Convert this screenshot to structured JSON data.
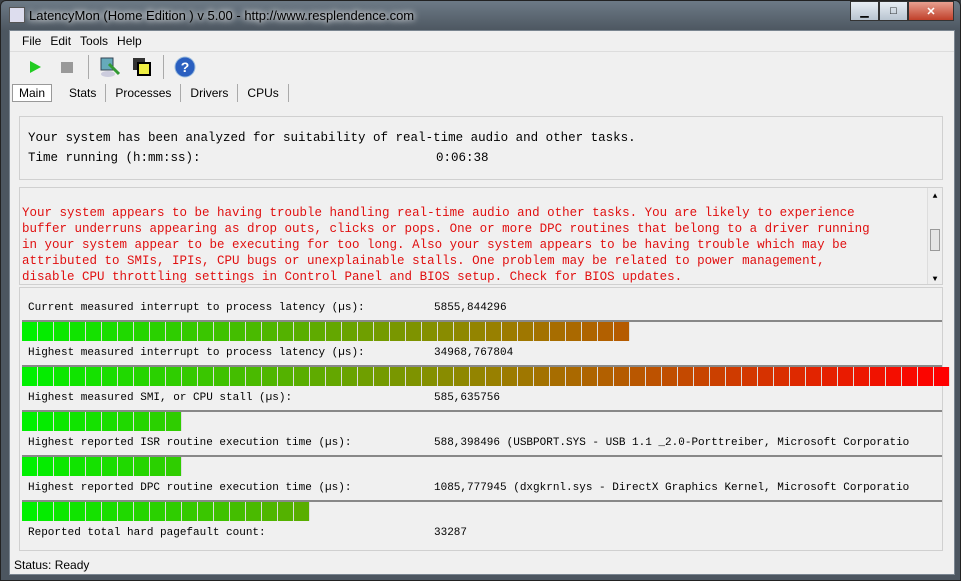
{
  "window": {
    "title": "LatencyMon  (Home Edition )  v 5.00 - http://www.resplendence.com"
  },
  "menu": [
    "File",
    "Edit",
    "Tools",
    "Help"
  ],
  "tabs": [
    "Main",
    "Stats",
    "Processes",
    "Drivers",
    "CPUs"
  ],
  "summary": {
    "line1": "Your system has been analyzed for suitability of real-time audio and other tasks.",
    "time_label": "Time running (h:mm:ss):",
    "time_value": "0:06:38"
  },
  "warning": "Your system appears to be having trouble handling real-time audio and other tasks. You are likely to experience\nbuffer underruns appearing as drop outs, clicks or pops. One or more DPC routines that belong to a driver running\nin your system appear to be executing for too long. Also your system appears to be having trouble which may be\nattributed to SMIs, IPIs, CPU bugs or unexplainable stalls. One problem may be related to power management,\ndisable CPU throttling settings in Control Panel and BIOS setup. Check for BIOS updates.",
  "metrics": [
    {
      "label": "Current measured interrupt to process latency (µs):",
      "value": "5855,844296",
      "fill": 0.66
    },
    {
      "label": "Highest measured interrupt to process latency (µs):",
      "value": "34968,767804",
      "fill": 1.0
    },
    {
      "label": "Highest measured SMI, or CPU stall (µs):",
      "value": "585,635756",
      "fill": 0.17
    },
    {
      "label": "Highest reported ISR routine execution time (µs):",
      "value": "588,398496   (USBPORT.SYS - USB 1.1 _2.0-Porttreiber, Microsoft Corporatio",
      "fill": 0.17
    },
    {
      "label": "Highest reported DPC routine execution time (µs):",
      "value": "1085,777945   (dxgkrnl.sys - DirectX Graphics Kernel, Microsoft Corporatio",
      "fill": 0.31
    },
    {
      "label": "Reported total hard pagefault count:",
      "value": "33287"
    }
  ],
  "status": "Status: Ready"
}
